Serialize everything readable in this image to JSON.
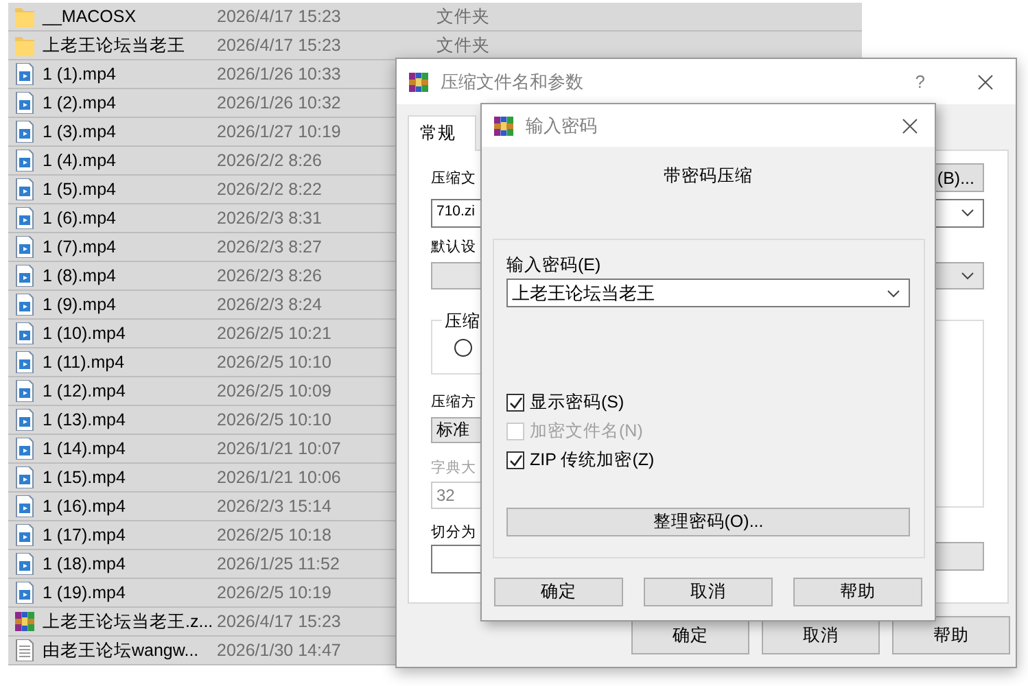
{
  "file_list": {
    "rows": [
      {
        "kind": "folder",
        "name": "__MACOSX",
        "date": "2026/4/17 15:23",
        "type": "文件夹",
        "selected": true
      },
      {
        "kind": "folder",
        "name": "上老王论坛当老王",
        "date": "2026/4/17 15:23",
        "type": "文件夹",
        "selected": true
      },
      {
        "kind": "video",
        "name": "1 (1).mp4",
        "date": "2026/1/26 10:33",
        "selected": true
      },
      {
        "kind": "video",
        "name": "1 (2).mp4",
        "date": "2026/1/26 10:32",
        "selected": true
      },
      {
        "kind": "video",
        "name": "1 (3).mp4",
        "date": "2026/1/27 10:19",
        "selected": true
      },
      {
        "kind": "video",
        "name": "1 (4).mp4",
        "date": "2026/2/2 8:26",
        "selected": true
      },
      {
        "kind": "video",
        "name": "1 (5).mp4",
        "date": "2026/2/2 8:22",
        "selected": true
      },
      {
        "kind": "video",
        "name": "1 (6).mp4",
        "date": "2026/2/3 8:31",
        "selected": true
      },
      {
        "kind": "video",
        "name": "1 (7).mp4",
        "date": "2026/2/3 8:27",
        "selected": true
      },
      {
        "kind": "video",
        "name": "1 (8).mp4",
        "date": "2026/2/3 8:26",
        "selected": true
      },
      {
        "kind": "video",
        "name": "1 (9).mp4",
        "date": "2026/2/3 8:24",
        "selected": true
      },
      {
        "kind": "video",
        "name": "1 (10).mp4",
        "date": "2026/2/5 10:21",
        "selected": true
      },
      {
        "kind": "video",
        "name": "1 (11).mp4",
        "date": "2026/2/5 10:10",
        "selected": true
      },
      {
        "kind": "video",
        "name": "1 (12).mp4",
        "date": "2026/2/5 10:09",
        "selected": true
      },
      {
        "kind": "video",
        "name": "1 (13).mp4",
        "date": "2026/2/5 10:10",
        "selected": true
      },
      {
        "kind": "video",
        "name": "1 (14).mp4",
        "date": "2026/1/21 10:07",
        "selected": true
      },
      {
        "kind": "video",
        "name": "1 (15).mp4",
        "date": "2026/1/21 10:06",
        "selected": true
      },
      {
        "kind": "video",
        "name": "1 (16).mp4",
        "date": "2026/2/3 15:14",
        "selected": true
      },
      {
        "kind": "video",
        "name": "1 (17).mp4",
        "date": "2026/2/5 10:18",
        "selected": true
      },
      {
        "kind": "video",
        "name": "1 (18).mp4",
        "date": "2026/1/25 11:52",
        "selected": true
      },
      {
        "kind": "video",
        "name": "1 (19).mp4",
        "date": "2026/2/5 10:19",
        "selected": true
      },
      {
        "kind": "archive",
        "name": "上老王论坛当老王.z...",
        "date": "2026/4/17 15:23",
        "selected": true
      },
      {
        "kind": "text",
        "name": "由老王论坛wangw...",
        "date": "2026/1/30 14:47",
        "selected": true
      }
    ]
  },
  "archive_dialog": {
    "title": "压缩文件名和参数",
    "help": "?",
    "tabs": [
      {
        "label": "常规",
        "selected": true
      }
    ],
    "archive_name_label": "压缩文",
    "browse_button": "(B)...",
    "archive_name_value": "710.zi",
    "profile_label": "默认设",
    "format_group_label": "压缩",
    "format_radio": {
      "checked": false
    },
    "method_label": "压缩方",
    "method_value": "标准",
    "dictionary": {
      "label": "字典大",
      "value": "32",
      "disabled": true
    },
    "split_label": "切分为",
    "buttons": [
      "确定",
      "取消",
      "帮助"
    ]
  },
  "password_dialog": {
    "title": "输入密码",
    "heading": "带密码压缩",
    "password_label": "输入密码(E)",
    "password_value": "上老王论坛当老王",
    "options": [
      {
        "label": "显示密码(S)",
        "checked": true,
        "disabled": false
      },
      {
        "label": "加密文件名(N)",
        "checked": false,
        "disabled": true
      },
      {
        "label": "ZIP 传统加密(Z)",
        "checked": true,
        "disabled": false
      }
    ],
    "organize_button": "整理密码(O)...",
    "buttons": [
      "确定",
      "取消",
      "帮助"
    ]
  }
}
